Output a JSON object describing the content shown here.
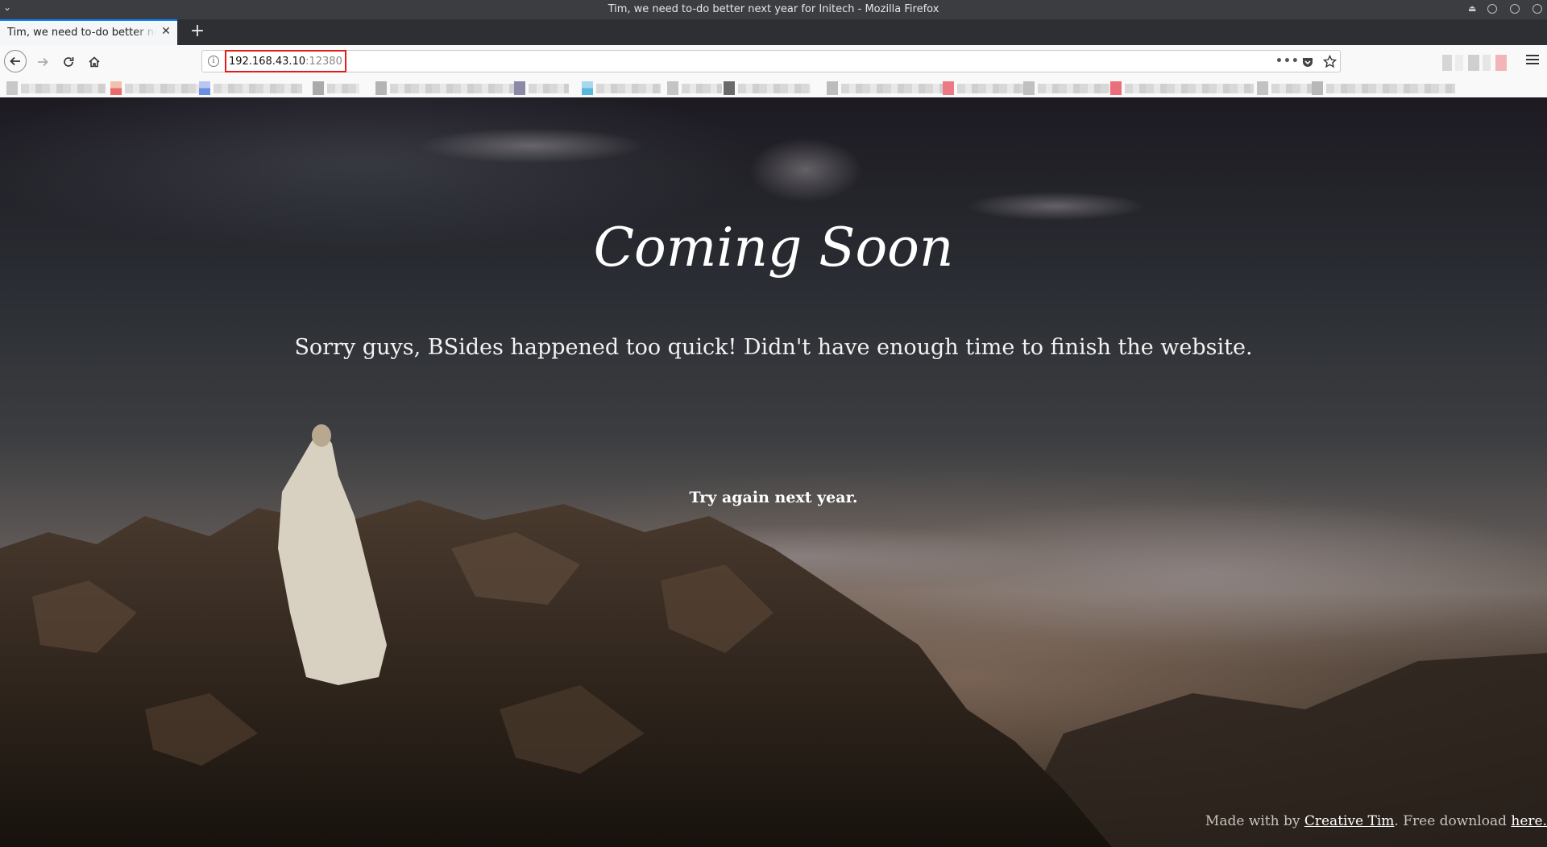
{
  "window": {
    "title": "Tim, we need to-do better next year for Initech - Mozilla Firefox"
  },
  "tab": {
    "label": "Tim, we need to-do better next year for Initech"
  },
  "navbar": {
    "url_host": "192.168.43.10",
    "url_port": ":12380"
  },
  "page": {
    "headline": "Coming Soon",
    "subline": "Sorry guys, BSides happened too quick! Didn't have enough time to finish the website.",
    "try_again": "Try again next year.",
    "footer": {
      "made_with": "Made with by ",
      "author_link": "Creative Tim",
      "middle": ". Free download ",
      "download_link": "here."
    }
  },
  "colors": {
    "url_highlight_border": "#e21b1b",
    "tab_accent": "#0a84ff"
  }
}
